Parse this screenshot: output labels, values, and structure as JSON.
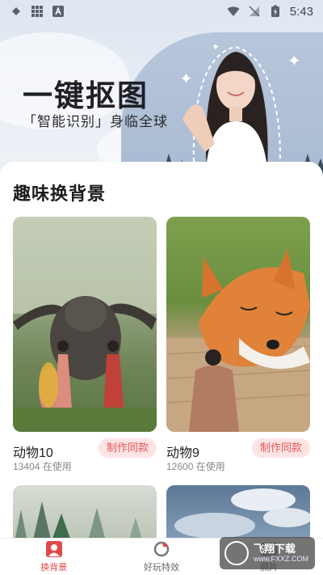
{
  "status_bar": {
    "time": "5:43"
  },
  "hero": {
    "title": "一键抠图",
    "subtitle": "「智能识别」身临全球"
  },
  "section": {
    "title": "趣味换背景"
  },
  "cards": [
    {
      "title": "动物10",
      "uses": "13404 在使用",
      "button": "制作同款"
    },
    {
      "title": "动物9",
      "uses": "12600 在使用",
      "button": "制作同款"
    }
  ],
  "nav": [
    {
      "label": "换背景",
      "icon": "portrait-icon",
      "active": true
    },
    {
      "label": "好玩特效",
      "icon": "effects-icon",
      "active": false
    },
    {
      "label": "照片",
      "icon": "photo-icon",
      "active": false
    }
  ],
  "watermark": {
    "text": "飞翔下载",
    "url": "www.FXXZ.COM"
  },
  "colors": {
    "accent": "#e04a4a",
    "button_bg": "#fde4e4"
  }
}
